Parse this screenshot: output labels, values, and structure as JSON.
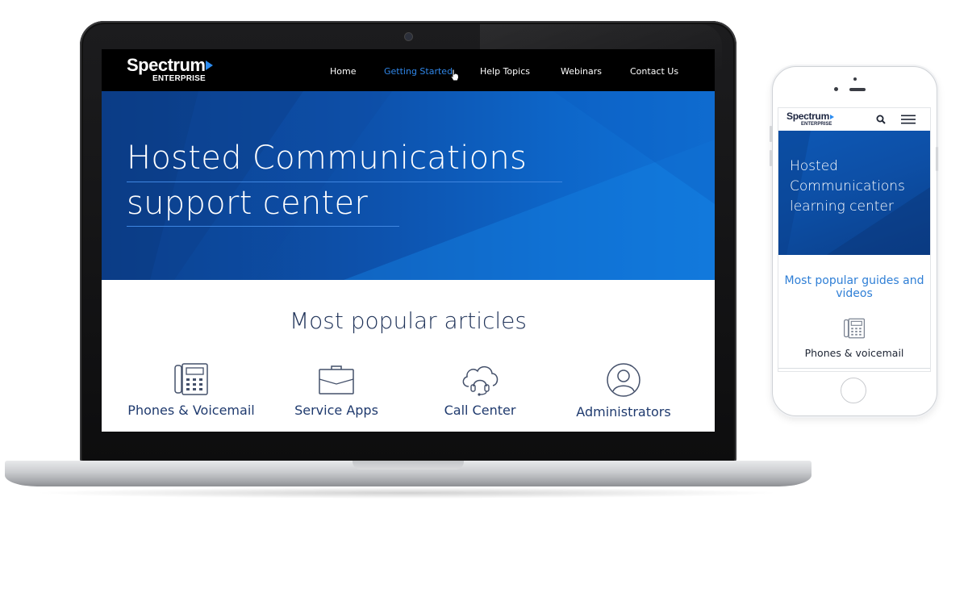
{
  "brand": {
    "name": "Spectrum",
    "sub": "ENTERPRISE",
    "accent_color": "#2c8cf0"
  },
  "desktop": {
    "nav": {
      "items": [
        {
          "label": "Home",
          "active": false
        },
        {
          "label": "Getting Started",
          "active": true
        },
        {
          "label": "Help Topics",
          "active": false
        },
        {
          "label": "Webinars",
          "active": false
        },
        {
          "label": "Contact Us",
          "active": false
        }
      ],
      "background": "#000000",
      "active_color": "#2f86e8"
    },
    "hero": {
      "title_line1": "Hosted Communications",
      "title_line2": "support center",
      "background": "#0d52ad"
    },
    "popular": {
      "title": "Most popular articles",
      "categories": [
        {
          "label": "Phones & Voicemail",
          "icon": "desk-phone-icon"
        },
        {
          "label": "Service Apps",
          "icon": "briefcase-icon"
        },
        {
          "label": "Call Center",
          "icon": "cloud-headset-icon"
        },
        {
          "label": "Administrators",
          "icon": "user-icon"
        }
      ]
    }
  },
  "mobile": {
    "header": {
      "icons": [
        "search-icon",
        "hamburger-menu-icon"
      ]
    },
    "hero": {
      "title_line1": "Hosted",
      "title_line2": "Communications",
      "title_line3": "learning center"
    },
    "popular": {
      "title": "Most popular guides and videos",
      "category": {
        "label": "Phones & voicemail",
        "icon": "desk-phone-icon"
      }
    }
  }
}
